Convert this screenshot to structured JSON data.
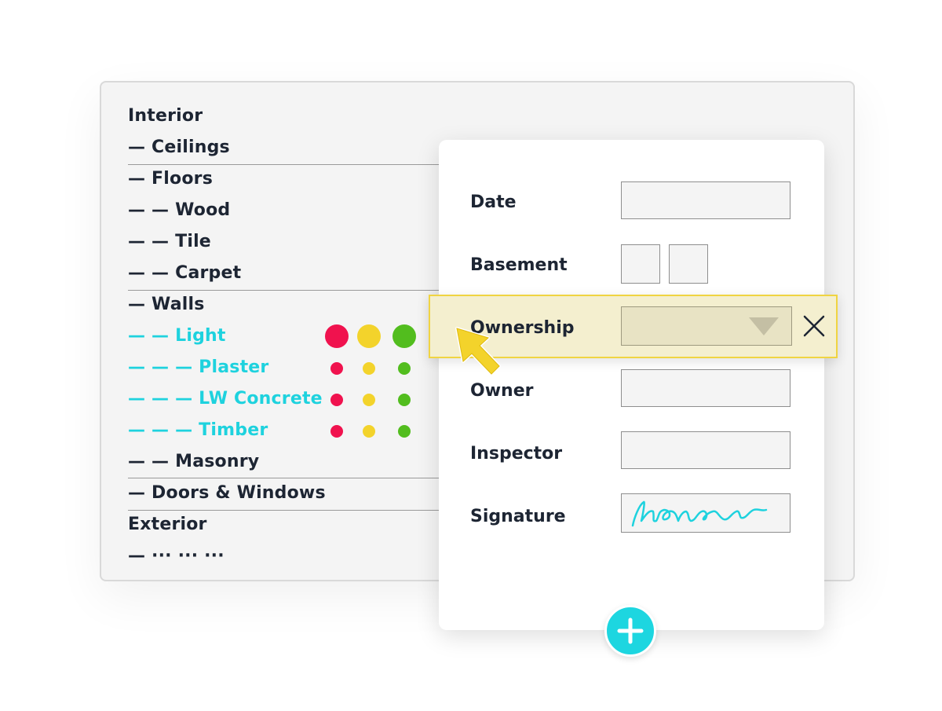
{
  "tree": [
    {
      "label": "Interior",
      "level": 0,
      "active": false
    },
    {
      "label": "— Ceilings",
      "level": 1,
      "active": false
    },
    {
      "label": "— Floors",
      "level": 1,
      "active": false
    },
    {
      "label": "— — Wood",
      "level": 2,
      "active": false
    },
    {
      "label": "— — Tile",
      "level": 2,
      "active": false
    },
    {
      "label": "— — Carpet",
      "level": 2,
      "active": false
    },
    {
      "label": "— Walls",
      "level": 1,
      "active": false
    },
    {
      "label": "— — Light",
      "level": 2,
      "active": true
    },
    {
      "label": "— — — Plaster",
      "level": 3,
      "active": true
    },
    {
      "label": "— — — LW Concrete",
      "level": 3,
      "active": true
    },
    {
      "label": "— — — Timber",
      "level": 3,
      "active": true
    },
    {
      "label": "— — Masonry",
      "level": 2,
      "active": false
    },
    {
      "label": "— Doors & Windows",
      "level": 1,
      "active": false
    },
    {
      "label": "Exterior",
      "level": 0,
      "active": false
    },
    {
      "label": "— ··· ··· ···",
      "level": 1,
      "active": false
    }
  ],
  "status_colors": {
    "red": "#f0124e",
    "yellow": "#f3d32b",
    "green": "#52bd1e"
  },
  "accent_color": "#1ed2de",
  "form": {
    "date_label": "Date",
    "basement_label": "Basement",
    "ownership_label": "Ownership",
    "owner_label": "Owner",
    "inspector_label": "Inspector",
    "signature_label": "Signature"
  },
  "icons": {
    "close": "close-icon",
    "dropdown": "chevron-down-icon",
    "cursor": "cursor-arrow-icon",
    "add": "plus-icon"
  }
}
